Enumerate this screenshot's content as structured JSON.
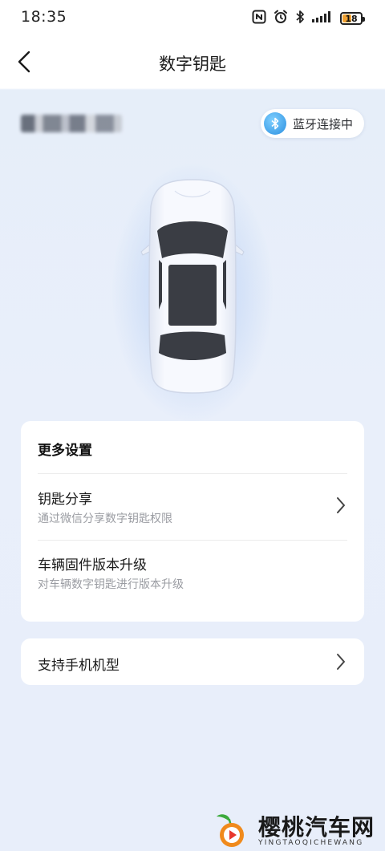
{
  "status_bar": {
    "time": "18:35",
    "battery": "18",
    "icons": [
      "nfc-icon",
      "alarm-icon",
      "bluetooth-icon",
      "signal-icon",
      "battery-icon"
    ]
  },
  "header": {
    "title": "数字钥匙",
    "back_icon": "back-arrow-icon"
  },
  "vehicle": {
    "bluetooth_status": "蓝牙连接中",
    "bluetooth_icon": "bluetooth-icon",
    "colors": {
      "bluetooth_accent": "#2b8fe0",
      "car_body": "#f4f7fd",
      "car_glass": "#3a3d44"
    }
  },
  "settings": {
    "section_title": "更多设置",
    "items": [
      {
        "title": "钥匙分享",
        "subtitle": "通过微信分享数字钥匙权限",
        "icon": "chevron-right-icon"
      },
      {
        "title": "车辆固件版本升级",
        "subtitle": "对车辆数字钥匙进行版本升级"
      }
    ]
  },
  "support": {
    "title": "支持手机机型",
    "icon": "chevron-right-icon"
  },
  "watermark": {
    "name": "樱桃汽车网",
    "sub": "YINGTAOQICHEWANG"
  }
}
